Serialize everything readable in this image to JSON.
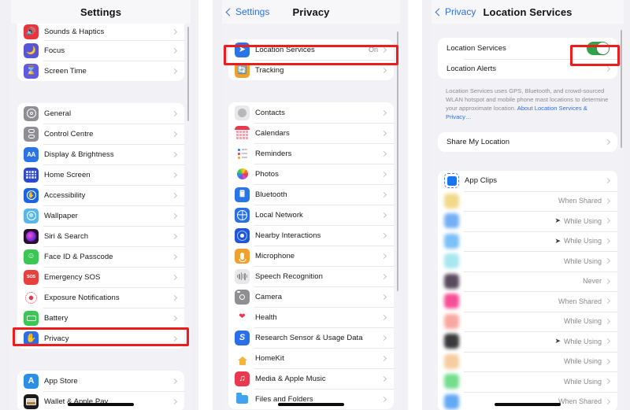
{
  "panel1": {
    "nav": {
      "title": "Settings"
    },
    "groups": [
      {
        "rows": [
          {
            "label": "Sounds & Haptics",
            "icon": "speaker-icon"
          },
          {
            "label": "Focus",
            "icon": "moon-icon"
          },
          {
            "label": "Screen Time",
            "icon": "hourglass-icon"
          }
        ]
      },
      {
        "rows": [
          {
            "label": "General",
            "icon": "gear-icon"
          },
          {
            "label": "Control Centre",
            "icon": "control-centre-icon"
          },
          {
            "label": "Display & Brightness",
            "icon": "aa-icon"
          },
          {
            "label": "Home Screen",
            "icon": "home-screen-icon"
          },
          {
            "label": "Accessibility",
            "icon": "accessibility-icon"
          },
          {
            "label": "Wallpaper",
            "icon": "wallpaper-icon"
          },
          {
            "label": "Siri & Search",
            "icon": "siri-icon"
          },
          {
            "label": "Face ID & Passcode",
            "icon": "face-id-icon"
          },
          {
            "label": "Emergency SOS",
            "icon": "sos-icon"
          },
          {
            "label": "Exposure Notifications",
            "icon": "exposure-icon"
          },
          {
            "label": "Battery",
            "icon": "battery-icon"
          },
          {
            "label": "Privacy",
            "icon": "hand-privacy-icon"
          }
        ]
      },
      {
        "rows": [
          {
            "label": "App Store",
            "icon": "app-store-icon"
          },
          {
            "label": "Wallet & Apple Pay",
            "icon": "wallet-icon"
          }
        ]
      }
    ]
  },
  "panel2": {
    "nav": {
      "back": "Settings",
      "title": "Privacy"
    },
    "groups": [
      {
        "rows": [
          {
            "label": "Location Services",
            "value": "On",
            "icon": "location-arrow-icon"
          },
          {
            "label": "Tracking",
            "value": "",
            "icon": "tracking-icon"
          }
        ]
      },
      {
        "rows": [
          {
            "label": "Contacts",
            "value": "",
            "icon": "contacts-icon"
          },
          {
            "label": "Calendars",
            "value": "",
            "icon": "calendars-icon"
          },
          {
            "label": "Reminders",
            "value": "",
            "icon": "reminders-icon"
          },
          {
            "label": "Photos",
            "value": "",
            "icon": "photos-icon"
          },
          {
            "label": "Bluetooth",
            "value": "",
            "icon": "bluetooth-icon"
          },
          {
            "label": "Local Network",
            "value": "",
            "icon": "local-network-icon"
          },
          {
            "label": "Nearby Interactions",
            "value": "",
            "icon": "nearby-interactions-icon"
          },
          {
            "label": "Microphone",
            "value": "",
            "icon": "microphone-icon"
          },
          {
            "label": "Speech Recognition",
            "value": "",
            "icon": "speech-recognition-icon"
          },
          {
            "label": "Camera",
            "value": "",
            "icon": "camera-icon"
          },
          {
            "label": "Health",
            "value": "",
            "icon": "health-heart-icon"
          },
          {
            "label": "Research Sensor & Usage Data",
            "value": "",
            "icon": "research-icon"
          },
          {
            "label": "HomeKit",
            "value": "",
            "icon": "homekit-icon"
          },
          {
            "label": "Media & Apple Music",
            "value": "",
            "icon": "music-note-icon"
          },
          {
            "label": "Files and Folders",
            "value": "",
            "icon": "folder-icon"
          }
        ]
      }
    ]
  },
  "panel3": {
    "nav": {
      "back": "Privacy",
      "title": "Location Services"
    },
    "toggle_row": {
      "label": "Location Services",
      "state": "on"
    },
    "alerts_row": {
      "label": "Location Alerts"
    },
    "note": {
      "text": "Location Services uses GPS, Bluetooth, and crowd-sourced WLAN hotspot and mobile phone mast locations to determine your approximate location. ",
      "link": "About Location Services & Privacy…"
    },
    "share_row": {
      "label": "Share My Location"
    },
    "apps": [
      {
        "label": "App Clips",
        "value": "",
        "arrow": false,
        "blurred": false,
        "icon_color": "#1676f3"
      },
      {
        "label": "",
        "value": "When Shared",
        "arrow": false,
        "blurred": true,
        "icon_color": "#f2d98a"
      },
      {
        "label": "",
        "value": "While Using",
        "arrow": true,
        "blurred": true,
        "icon_color": "#74aff5"
      },
      {
        "label": "",
        "value": "While Using",
        "arrow": true,
        "blurred": true,
        "icon_color": "#7cc0f7"
      },
      {
        "label": "",
        "value": "While Using",
        "arrow": false,
        "blurred": true,
        "icon_color": "#a8e6f0"
      },
      {
        "label": "",
        "value": "Never",
        "arrow": false,
        "blurred": true,
        "icon_color": "#5a4a5e"
      },
      {
        "label": "",
        "value": "When Shared",
        "arrow": false,
        "blurred": true,
        "icon_color": "#f54f96"
      },
      {
        "label": "",
        "value": "While Using",
        "arrow": false,
        "blurred": true,
        "icon_color": "#f8a8a0"
      },
      {
        "label": "",
        "value": "While Using",
        "arrow": true,
        "blurred": true,
        "icon_color": "#3a3a3c"
      },
      {
        "label": "",
        "value": "While Using",
        "arrow": false,
        "blurred": true,
        "icon_color": "#f6cda0"
      },
      {
        "label": "",
        "value": "While Using",
        "arrow": false,
        "blurred": true,
        "icon_color": "#74dd8e"
      },
      {
        "label": "",
        "value": "When Shared",
        "arrow": false,
        "blurred": true,
        "icon_color": "#63a8f5"
      }
    ]
  },
  "highlights": {
    "color": "#ee1c1c",
    "boxes": [
      {
        "name": "privacy-row-highlight",
        "panel": 1
      },
      {
        "name": "location-services-row-highlight",
        "panel": 2
      },
      {
        "name": "location-services-toggle-highlight",
        "panel": 3
      }
    ]
  },
  "glyphs": {
    "chevron": "›",
    "arrow_location": "➤"
  }
}
